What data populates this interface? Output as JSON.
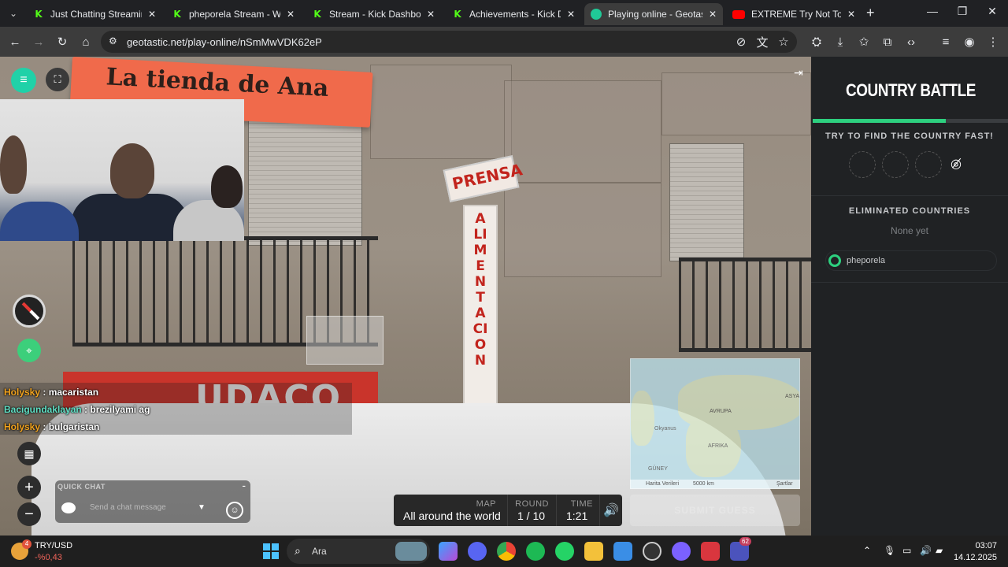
{
  "browser": {
    "tabs": [
      {
        "title": "Just Chatting Streaming - I",
        "icon": "kick-icon",
        "active": false
      },
      {
        "title": "pheporela Stream - Watch",
        "icon": "kick-icon",
        "active": false
      },
      {
        "title": "Stream - Kick Dashboard",
        "icon": "kick-icon",
        "active": false
      },
      {
        "title": "Achievements - Kick Dashb",
        "icon": "kick-icon",
        "active": false
      },
      {
        "title": "Playing online - Geotastic",
        "icon": "geotastic-icon",
        "active": true
      },
      {
        "title": "EXTREME Try Not To Laugh",
        "icon": "youtube-icon",
        "active": false
      }
    ],
    "url": "geotastic.net/play-online/nSmMwVDK62eP"
  },
  "game": {
    "chat": [
      {
        "user": "Holysky",
        "message": ": macaristan",
        "color": "#f0a21e"
      },
      {
        "user": "Bacigundaklayan",
        "message": ": brezilyami ag",
        "color": "#5fe0c5"
      },
      {
        "user": "Holysky",
        "message": ": bulgaristan",
        "color": "#f0a21e"
      }
    ],
    "quick_chat": {
      "title": "QUICK CHAT",
      "placeholder": "Send a chat message"
    },
    "hud": {
      "map_label": "MAP",
      "map_value": "All around the world",
      "round_label": "ROUND",
      "round_value": "1 / 10",
      "time_label": "TIME",
      "time_value": "1:21"
    },
    "minimap": {
      "labels": [
        "AVRUPA",
        "ASYA",
        "AFRIKA",
        "GÜNEY",
        "Okyanus"
      ],
      "footer": [
        "Harita Verileri",
        "5000 km",
        "Şartlar"
      ]
    },
    "submit_label": "SUBMIT GUESS",
    "scene": {
      "shop_sign": "La tienda de Ana",
      "prensa": "PRENSA",
      "alimentacion": "ALIMENTACION",
      "udaco": "UDACO"
    }
  },
  "panel": {
    "logo": "COUNTRY BATTLE",
    "progress": 0.68,
    "prompt": "TRY TO FIND THE COUNTRY FAST!",
    "eliminated_title": "ELIMINATED COUNTRIES",
    "none_yet": "None yet",
    "player": "pheporela",
    "accent": "#2dd07f"
  },
  "taskbar": {
    "weather_badge": "4",
    "ticker": "TRY/USD",
    "change": "-%0,43",
    "search": "Ara",
    "teams_badge": "62",
    "time": "03:07",
    "date": "14.12.2025"
  }
}
